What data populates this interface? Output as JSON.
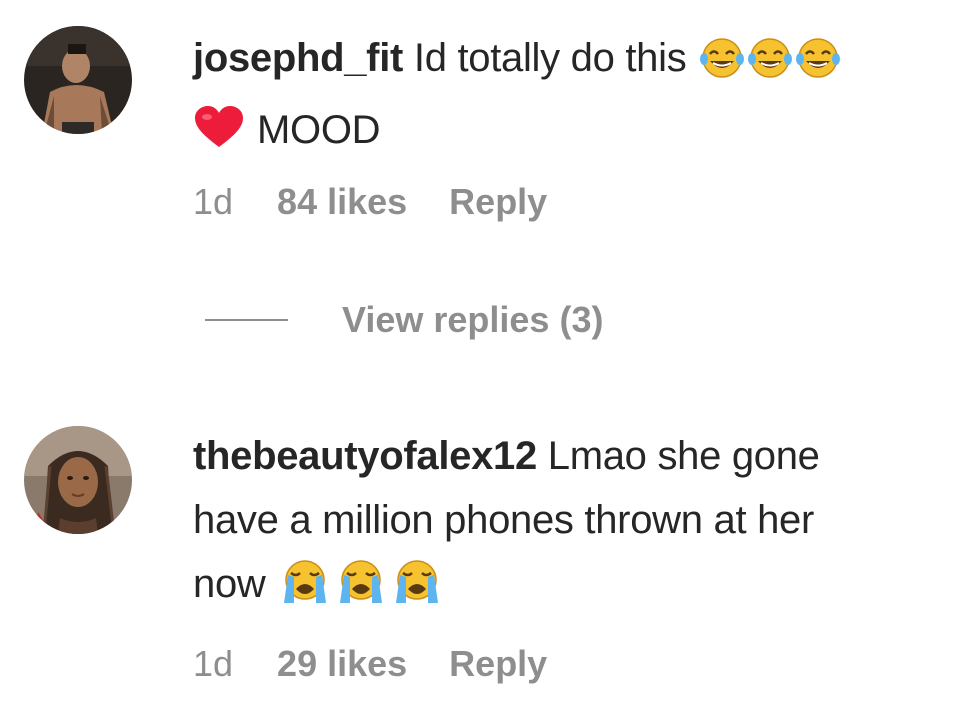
{
  "comments": [
    {
      "username": "josephd_fit",
      "text_line1": "Id totally do this",
      "text_line2": "MOOD",
      "emojis_line1": [
        "face-with-tears-of-joy",
        "face-with-tears-of-joy",
        "face-with-tears-of-joy"
      ],
      "emoji_line2": "red-heart",
      "time": "1d",
      "likes": "84 likes",
      "reply": "Reply",
      "view_replies": "View replies (3)"
    },
    {
      "username": "thebeautyofalex12",
      "text_line1": "Lmao she gone",
      "text_line2": "have a million phones thrown at her",
      "text_line3": "now",
      "emojis_line3": [
        "loudly-crying-face",
        "loudly-crying-face",
        "loudly-crying-face"
      ],
      "time": "1d",
      "likes": "29 likes",
      "reply": "Reply"
    }
  ],
  "colors": {
    "text": "#262626",
    "secondary": "#8e8e8e",
    "heart": "#ed1c3a",
    "emoji_yellow": "#f7c230"
  }
}
